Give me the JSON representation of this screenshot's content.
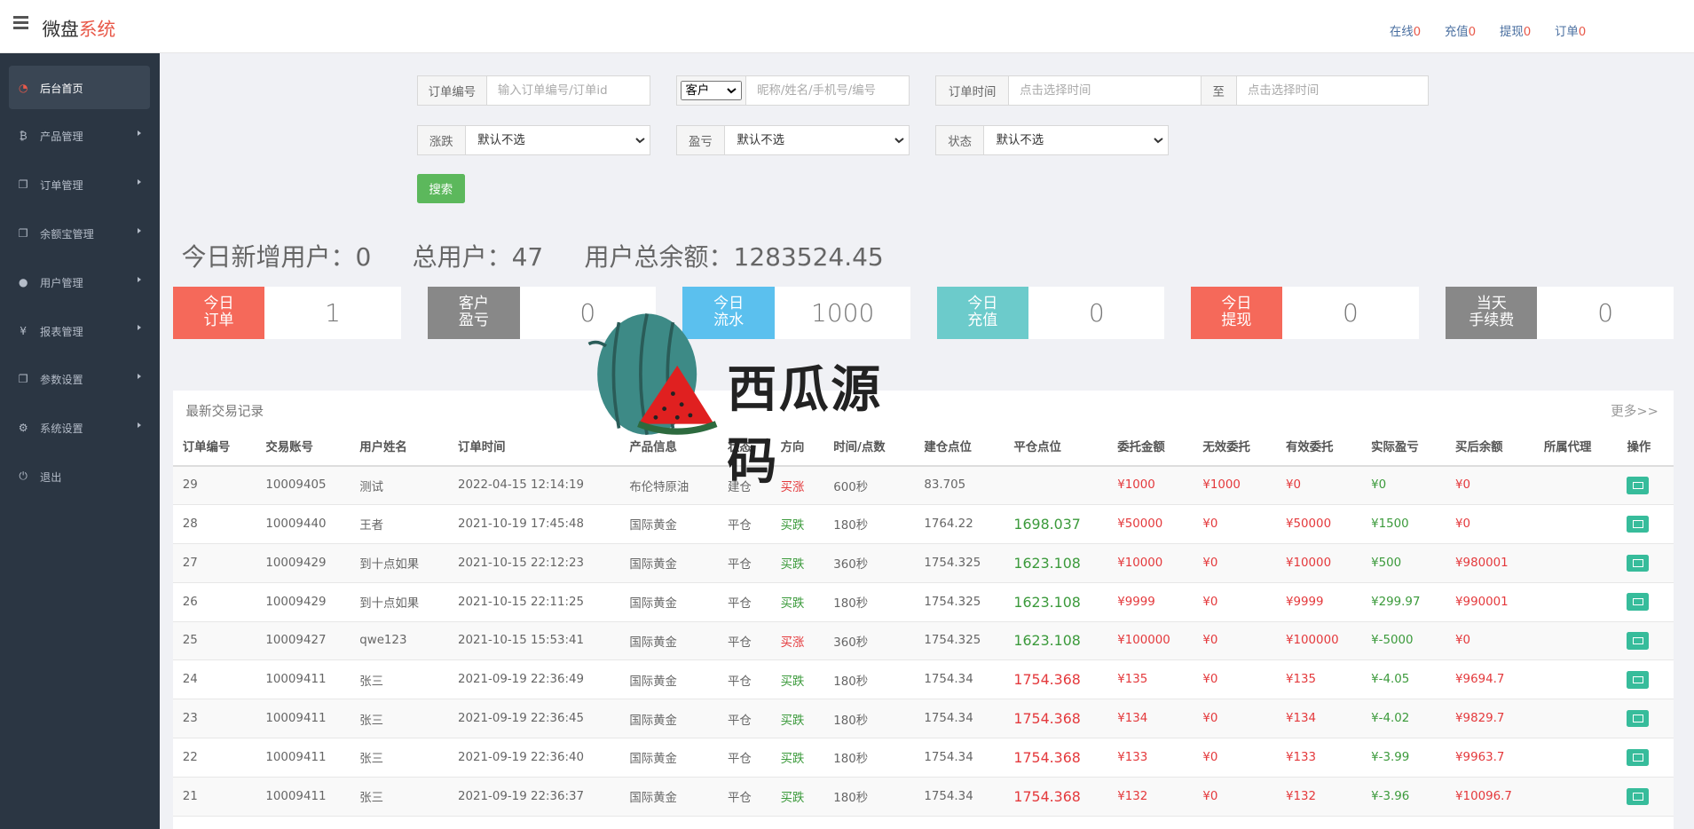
{
  "header": {
    "brand_main": "微盘",
    "brand_accent": "系统",
    "links": [
      {
        "label": "在线",
        "count": "0"
      },
      {
        "label": "充值",
        "count": "0"
      },
      {
        "label": "提现",
        "count": "0"
      },
      {
        "label": "订单",
        "count": "0"
      }
    ]
  },
  "sidebar": {
    "items": [
      {
        "label": "后台首页",
        "icon": "dashboard-icon",
        "active": true
      },
      {
        "label": "产品管理",
        "icon": "bitcoin-icon"
      },
      {
        "label": "订单管理",
        "icon": "copy-icon"
      },
      {
        "label": "余额宝管理",
        "icon": "copy-icon"
      },
      {
        "label": "用户管理",
        "icon": "user-icon"
      },
      {
        "label": "报表管理",
        "icon": "yen-icon"
      },
      {
        "label": "参数设置",
        "icon": "copy-icon"
      },
      {
        "label": "系统设置",
        "icon": "gears-icon"
      },
      {
        "label": "退出",
        "icon": "power-icon"
      }
    ]
  },
  "filters": {
    "order_no_label": "订单编号",
    "order_no_placeholder": "输入订单编号/订单id",
    "customer_select": "客户",
    "customer_placeholder": "昵称/姓名/手机号/编号",
    "order_time_label": "订单时间",
    "order_time_placeholder": "点击选择时间",
    "to_label": "至",
    "to_placeholder": "点击选择时间",
    "rise_fall_label": "涨跌",
    "rise_fall_value": "默认不选",
    "profit_label": "盈亏",
    "profit_value": "默认不选",
    "status_label": "状态",
    "status_value": "默认不选",
    "search_button": "搜索"
  },
  "stats": {
    "new_users_today": "今日新增用户：0",
    "total_users": "总用户：47",
    "total_balance": "用户总余额：1283524.45"
  },
  "cards": [
    {
      "title1": "今日",
      "title2": "订单",
      "value": "1",
      "color": "#f5695a"
    },
    {
      "title1": "客户",
      "title2": "盈亏",
      "value": "0",
      "color": "#888888"
    },
    {
      "title1": "今日",
      "title2": "流水",
      "value": "1000",
      "color": "#5bc0ee"
    },
    {
      "title1": "今日",
      "title2": "充值",
      "value": "0",
      "color": "#6ccbcb"
    },
    {
      "title1": "今日",
      "title2": "提现",
      "value": "0",
      "color": "#f5695a"
    },
    {
      "title1": "当天",
      "title2": "手续费",
      "value": "0",
      "color": "#888888"
    }
  ],
  "watermark": {
    "text": "西瓜源码"
  },
  "records": {
    "title": "最新交易记录",
    "more": "更多>>",
    "columns": [
      "订单编号",
      "交易账号",
      "用户姓名",
      "订单时间",
      "产品信息",
      "状态",
      "方向",
      "时间/点数",
      "建仓点位",
      "平仓点位",
      "委托金额",
      "无效委托",
      "有效委托",
      "实际盈亏",
      "买后余额",
      "所属代理",
      "操作"
    ],
    "rows": [
      {
        "id": "29",
        "acct": "10009405",
        "name": "测试",
        "time": "2022-04-15 12:14:19",
        "product": "布伦特原油",
        "status": "建仓",
        "dir": "买涨",
        "dur": "600秒",
        "open": "83.705",
        "close": "",
        "amt": "¥1000",
        "invalid": "¥1000",
        "valid": "¥0",
        "pnl": "¥0",
        "bal": "¥0",
        "agent": ""
      },
      {
        "id": "28",
        "acct": "10009440",
        "name": "王者",
        "time": "2021-10-19 17:45:48",
        "product": "国际黄金",
        "status": "平仓",
        "dir": "买跌",
        "dur": "180秒",
        "open": "1764.22",
        "close": "1698.037",
        "amt": "¥50000",
        "invalid": "¥0",
        "valid": "¥50000",
        "pnl": "¥1500",
        "bal": "¥0",
        "agent": ""
      },
      {
        "id": "27",
        "acct": "10009429",
        "name": "到十点如果",
        "time": "2021-10-15 22:12:23",
        "product": "国际黄金",
        "status": "平仓",
        "dir": "买跌",
        "dur": "360秒",
        "open": "1754.325",
        "close": "1623.108",
        "amt": "¥10000",
        "invalid": "¥0",
        "valid": "¥10000",
        "pnl": "¥500",
        "bal": "¥980001",
        "agent": ""
      },
      {
        "id": "26",
        "acct": "10009429",
        "name": "到十点如果",
        "time": "2021-10-15 22:11:25",
        "product": "国际黄金",
        "status": "平仓",
        "dir": "买跌",
        "dur": "180秒",
        "open": "1754.325",
        "close": "1623.108",
        "amt": "¥9999",
        "invalid": "¥0",
        "valid": "¥9999",
        "pnl": "¥299.97",
        "bal": "¥990001",
        "agent": ""
      },
      {
        "id": "25",
        "acct": "10009427",
        "name": "qwe123",
        "time": "2021-10-15 15:53:41",
        "product": "国际黄金",
        "status": "平仓",
        "dir": "买涨",
        "dur": "360秒",
        "open": "1754.325",
        "close": "1623.108",
        "amt": "¥100000",
        "invalid": "¥0",
        "valid": "¥100000",
        "pnl": "¥-5000",
        "bal": "¥0",
        "agent": ""
      },
      {
        "id": "24",
        "acct": "10009411",
        "name": "张三",
        "time": "2021-09-19 22:36:49",
        "product": "国际黄金",
        "status": "平仓",
        "dir": "买跌",
        "dur": "180秒",
        "open": "1754.34",
        "close": "1754.368",
        "amt": "¥135",
        "invalid": "¥0",
        "valid": "¥135",
        "pnl": "¥-4.05",
        "bal": "¥9694.7",
        "agent": ""
      },
      {
        "id": "23",
        "acct": "10009411",
        "name": "张三",
        "time": "2021-09-19 22:36:45",
        "product": "国际黄金",
        "status": "平仓",
        "dir": "买跌",
        "dur": "180秒",
        "open": "1754.34",
        "close": "1754.368",
        "amt": "¥134",
        "invalid": "¥0",
        "valid": "¥134",
        "pnl": "¥-4.02",
        "bal": "¥9829.7",
        "agent": ""
      },
      {
        "id": "22",
        "acct": "10009411",
        "name": "张三",
        "time": "2021-09-19 22:36:40",
        "product": "国际黄金",
        "status": "平仓",
        "dir": "买跌",
        "dur": "180秒",
        "open": "1754.34",
        "close": "1754.368",
        "amt": "¥133",
        "invalid": "¥0",
        "valid": "¥133",
        "pnl": "¥-3.99",
        "bal": "¥9963.7",
        "agent": ""
      },
      {
        "id": "21",
        "acct": "10009411",
        "name": "张三",
        "time": "2021-09-19 22:36:37",
        "product": "国际黄金",
        "status": "平仓",
        "dir": "买跌",
        "dur": "180秒",
        "open": "1754.34",
        "close": "1754.368",
        "amt": "¥132",
        "invalid": "¥0",
        "valid": "¥132",
        "pnl": "¥-3.96",
        "bal": "¥10096.7",
        "agent": ""
      }
    ]
  }
}
